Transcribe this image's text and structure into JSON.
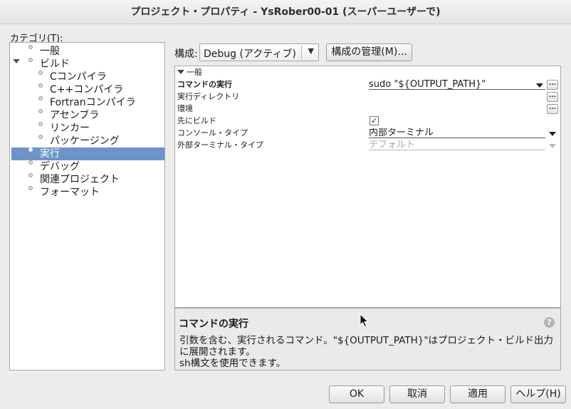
{
  "window": {
    "title": "プロジェクト・プロパティ - YsRober00-01 (スーパーユーザーで)"
  },
  "categories": {
    "label": "カテゴリ(T):",
    "items": [
      {
        "label": "一般"
      },
      {
        "label": "ビルド"
      },
      {
        "label": "Cコンパイラ"
      },
      {
        "label": "C++コンパイラ"
      },
      {
        "label": "Fortranコンパイラ"
      },
      {
        "label": "アセンブラ"
      },
      {
        "label": "リンカー"
      },
      {
        "label": "パッケージング"
      },
      {
        "label": "実行"
      },
      {
        "label": "デバッグ"
      },
      {
        "label": "関連プロジェクト"
      },
      {
        "label": "フォーマット"
      }
    ],
    "selected": "実行"
  },
  "config": {
    "label": "構成:",
    "value": "Debug (アクティブ)",
    "manage_button": "構成の管理(M)..."
  },
  "properties": {
    "section": "一般",
    "rows": [
      {
        "label": "コマンドの実行",
        "value": "sudo \"${OUTPUT_PATH}\""
      },
      {
        "label": "実行ディレクトリ",
        "value": ""
      },
      {
        "label": "環境",
        "value": ""
      },
      {
        "label": "先にビルド",
        "checked": true,
        "check_glyph": "✓"
      },
      {
        "label": "コンソール・タイプ",
        "value": "内部ターミナル"
      },
      {
        "label": "外部ターミナル・タイプ",
        "value": "デフォルト"
      }
    ],
    "ellipsis_label": "..."
  },
  "description": {
    "title": "コマンドの実行",
    "text": "引数を含む、実行されるコマンド。\"${OUTPUT_PATH}\"はプロジェクト・ビルド出力に展開されます。",
    "text2": "sh構文を使用できます。",
    "help_glyph": "?"
  },
  "buttons": {
    "ok": "OK",
    "cancel": "取消",
    "apply": "適用",
    "help": "ヘルプ(H)"
  },
  "colors": {
    "selection": "#6d93c8",
    "background": "#edeceb"
  }
}
